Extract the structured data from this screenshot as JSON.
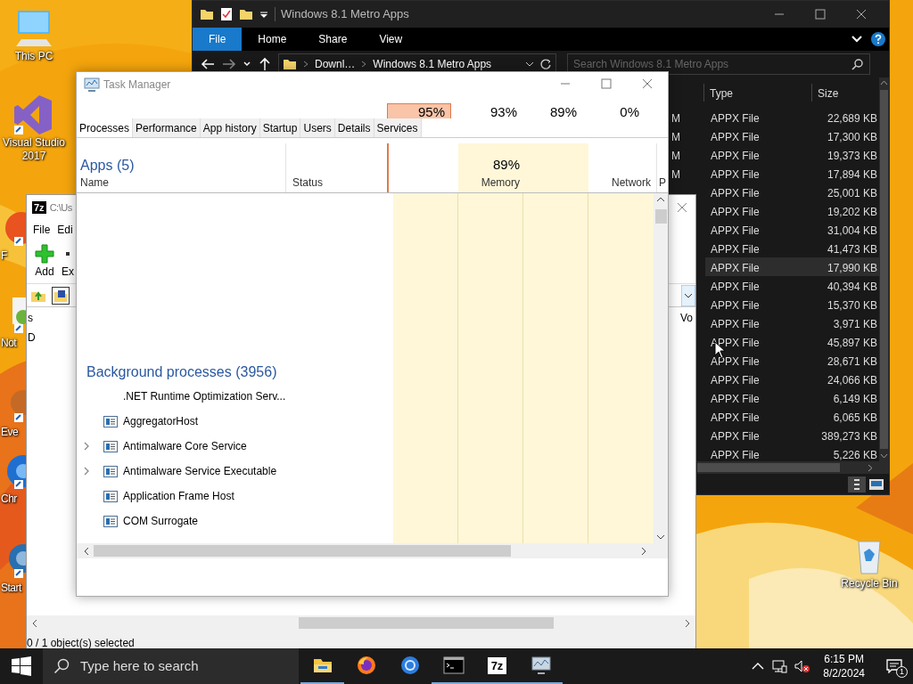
{
  "desktop_icons": [
    {
      "kind": "pc",
      "label": "This PC"
    },
    {
      "kind": "vs",
      "label": "Visual Studio 2017"
    },
    {
      "kind": "firefox",
      "label": "F"
    },
    {
      "kind": "notepad",
      "label": "Not"
    },
    {
      "kind": "event",
      "label": "Eve"
    },
    {
      "kind": "chrome",
      "label": "Chr"
    },
    {
      "kind": "start",
      "label": "Start"
    },
    {
      "kind": "recycle",
      "label": "Recycle Bin"
    }
  ],
  "explorer": {
    "title": "Windows 8.1 Metro Apps",
    "ribbon_tabs": [
      {
        "label": "File",
        "selected": true
      },
      {
        "label": "Home",
        "selected": false
      },
      {
        "label": "Share",
        "selected": false
      },
      {
        "label": "View",
        "selected": false
      }
    ],
    "breadcrumb": [
      "Downl…",
      "Windows 8.1 Metro Apps"
    ],
    "search": {
      "placeholder": "Search Windows 8.1 Metro Apps"
    },
    "columns": [
      "Type",
      "Size"
    ],
    "rows": [
      {
        "column_1": "M",
        "type": "APPX File",
        "size": "22,689 KB",
        "hovered": false
      },
      {
        "column_1": "M",
        "type": "APPX File",
        "size": "17,300 KB",
        "hovered": false
      },
      {
        "column_1": "M",
        "type": "APPX File",
        "size": "19,373 KB",
        "hovered": false
      },
      {
        "column_1": "M",
        "type": "APPX File",
        "size": "17,894 KB",
        "hovered": false
      },
      {
        "type": "APPX File",
        "size": "25,001 KB",
        "hovered": false
      },
      {
        "type": "APPX File",
        "size": "19,202 KB",
        "hovered": false
      },
      {
        "type": "APPX File",
        "size": "31,004 KB",
        "hovered": false
      },
      {
        "type": "APPX File",
        "size": "41,473 KB",
        "hovered": false
      },
      {
        "type": "APPX File",
        "size": "17,990 KB",
        "hovered": true
      },
      {
        "type": "APPX File",
        "size": "40,394 KB",
        "hovered": false
      },
      {
        "type": "APPX File",
        "size": "15,370 KB",
        "hovered": false
      },
      {
        "type": "APPX File",
        "size": "3,971 KB",
        "hovered": false
      },
      {
        "type": "APPX File",
        "size": "45,897 KB",
        "hovered": false
      },
      {
        "type": "APPX File",
        "size": "28,671 KB",
        "hovered": false
      },
      {
        "type": "APPX File",
        "size": "24,066 KB",
        "hovered": false
      },
      {
        "type": "APPX File",
        "size": "6,149 KB",
        "hovered": false
      },
      {
        "type": "APPX File",
        "size": "6,065 KB",
        "hovered": false
      },
      {
        "type": "APPX File",
        "size": "389,273 KB",
        "hovered": false
      },
      {
        "type": "APPX File",
        "size": "5,226 KB",
        "hovered": false
      }
    ]
  },
  "sevenzip": {
    "logo": "7z",
    "title": "C:\\Us",
    "menu": [
      "File",
      "Edi"
    ],
    "toolbar": [
      "Add",
      "Ex"
    ],
    "columns": [
      "s",
      "Vo"
    ],
    "rows": [
      "D"
    ],
    "status_bar": "0 / 1 object(s) selected"
  },
  "task_manager": {
    "title": "Task Manager",
    "usage": [
      {
        "value": "95%",
        "highlighted": true
      },
      {
        "value": "93%",
        "highlighted": false
      },
      {
        "value": "89%",
        "highlighted": false
      },
      {
        "value": "0%",
        "highlighted": false
      }
    ],
    "tabs": [
      {
        "label": "Processes",
        "selected": true
      },
      {
        "label": "Performance",
        "selected": false
      },
      {
        "label": "App history",
        "selected": false
      },
      {
        "label": "Startup",
        "selected": false
      },
      {
        "label": "Users",
        "selected": false
      },
      {
        "label": "Details",
        "selected": false
      },
      {
        "label": "Services",
        "selected": false
      }
    ],
    "apps_heading": "Apps (5)",
    "columns": {
      "name": "Name",
      "status": "Status",
      "memory_percent": "89%",
      "memory": "Memory",
      "network": "Network",
      "column_7": "P"
    },
    "group_heading": "Background processes (3956)",
    "processes": [
      {
        "kind": "blank",
        "name": ".NET Runtime Optimization Serv...",
        "expandable": false
      },
      {
        "kind": "app",
        "name": "AggregatorHost",
        "expandable": false
      },
      {
        "kind": "app",
        "name": "Antimalware Core Service",
        "expandable": true
      },
      {
        "kind": "app",
        "name": "Antimalware Service Executable",
        "expandable": true
      },
      {
        "kind": "app",
        "name": "Application Frame Host",
        "expandable": false
      },
      {
        "kind": "app",
        "name": "COM Surrogate",
        "expandable": false
      }
    ]
  },
  "taskbar": {
    "search": {
      "placeholder": "Type here to search"
    },
    "apps": [
      {
        "kind": "folder",
        "running": true
      },
      {
        "kind": "firefox",
        "running": false
      },
      {
        "kind": "chrome",
        "running": false
      },
      {
        "kind": "terminal",
        "running": true
      },
      {
        "kind": "sevenzip",
        "label": "7z",
        "running": true
      },
      {
        "kind": "monitor",
        "running": true
      }
    ],
    "time": "6:15 PM",
    "date": "8/2/2024",
    "notifications": "1"
  }
}
